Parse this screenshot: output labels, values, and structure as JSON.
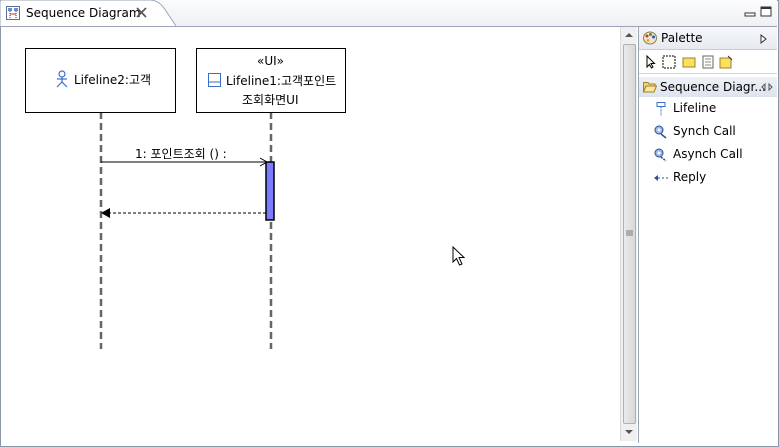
{
  "editor_tab": {
    "title": "Sequence Diagram"
  },
  "lifelines": [
    {
      "name": "Lifeline2:고객"
    },
    {
      "stereotype": "«UI»",
      "name_line1": "Lifeline1:고객포인트",
      "name_line2": "조회화면UI"
    }
  ],
  "messages": [
    {
      "label": "1:  포인트조회 () :"
    }
  ],
  "palette": {
    "title": "Palette",
    "drawer": "Sequence Diagr...",
    "entries": [
      {
        "label": "Lifeline",
        "icon": "lifeline-icon"
      },
      {
        "label": "Synch Call",
        "icon": "synch-call-icon"
      },
      {
        "label": "Asynch Call",
        "icon": "asynch-call-icon"
      },
      {
        "label": "Reply",
        "icon": "reply-icon"
      }
    ]
  },
  "colors": {
    "activation": "#7b7bff",
    "border": "#9aa4b6"
  }
}
